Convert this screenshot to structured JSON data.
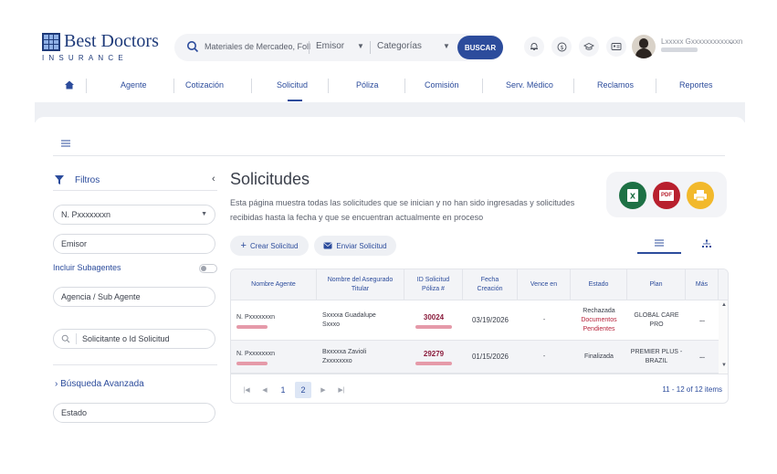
{
  "brand": {
    "name": "Best Doctors",
    "sub": "INSURANCE"
  },
  "search": {
    "text": "Materiales de Mercadeo, Foll",
    "emisor": "Emisor",
    "categorias": "Categorías",
    "button": "BUSCAR"
  },
  "header_icons": [
    "bell-icon",
    "dollar-icon",
    "graduation-cap-icon",
    "id-card-icon"
  ],
  "user": {
    "name": "Lxxxxx Gxxxxxxxxxxxxxn"
  },
  "nav": {
    "items": [
      "Agente",
      "Cotización",
      "Solicitud",
      "Póliza",
      "Comisión",
      "Serv. Médico",
      "Reclamos",
      "Reportes"
    ]
  },
  "sidebar": {
    "title": "Filtros",
    "agent_select": "N. Pxxxxxxxn",
    "emisor_placeholder": "Emisor",
    "incluir": "Incluir Subagentes",
    "agencia_placeholder": "Agencia / Sub Agente",
    "solicitante_placeholder": "Solicitante o Id Solicitud",
    "advanced": "Búsqueda Avanzada",
    "estado_placeholder": "Estado"
  },
  "main": {
    "title": "Solicitudes",
    "description": "Esta página muestra todas las solicitudes que se inician y no han sido ingresadas y solicitudes recibidas hasta la fecha y que se encuentran actualmente en proceso",
    "crear": "Crear Solicitud",
    "enviar": "Enviar Solicitud",
    "export": {
      "pdf": "PDF"
    }
  },
  "table": {
    "columns": [
      "Nombre Agente",
      "Nombre del Asegurado Titular",
      "ID Solicitud Póliza #",
      "Fecha Creación",
      "Vence en",
      "Estado",
      "Plan",
      "Más"
    ],
    "rows": [
      {
        "agent": "N. Pxxxxxxxn",
        "insured": "Sxxxxa Guadalupe",
        "insured2": "Sxxxo",
        "id": "30024",
        "date": "03/19/2026",
        "vence": "-",
        "estado": [
          "Rechazada",
          "Documentos",
          "Pendientes"
        ],
        "plan": [
          "GLOBAL CARE",
          "PRO"
        ],
        "more": "..."
      },
      {
        "agent": "N. Pxxxxxxxn",
        "insured": "Bxxxxxa Zavioli",
        "insured2": "Zxxxxxxxo",
        "id": "29279",
        "date": "01/15/2026",
        "vence": "-",
        "estado": [
          "Finalizada"
        ],
        "plan": [
          "PREMIER PLUS -",
          "BRAZIL"
        ],
        "more": "..."
      }
    ]
  },
  "pager": {
    "pages": [
      "1",
      "2"
    ],
    "active": "2",
    "items": "11 - 12 of 12 items"
  },
  "colors": {
    "primary": "#2c4c9c",
    "maroon": "#8a1c3c",
    "excel": "#1e7145",
    "pdf": "#b8202e",
    "print": "#f2b92c"
  }
}
